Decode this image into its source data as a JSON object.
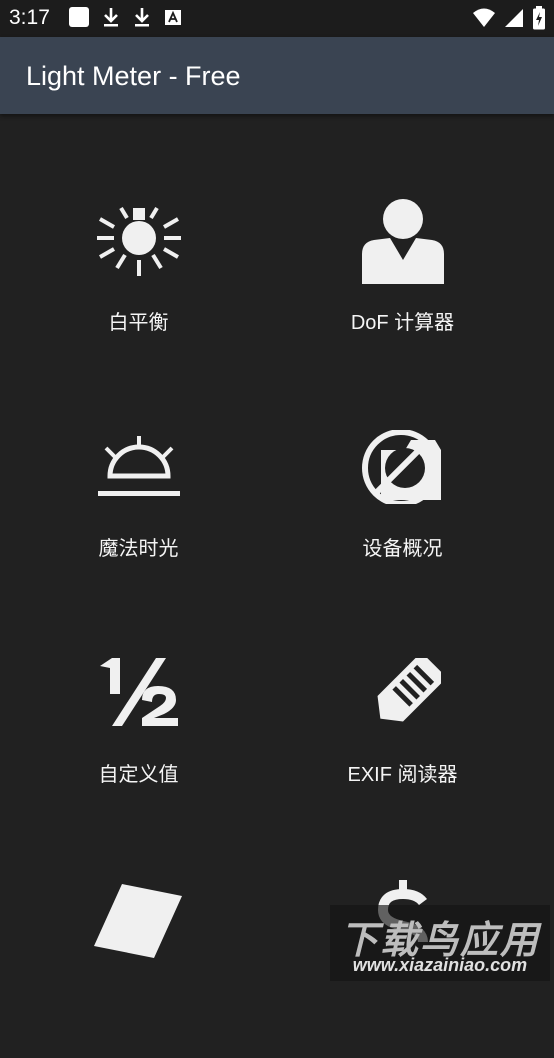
{
  "status_bar": {
    "time": "3:17",
    "left_icons": [
      "notification-square-icon",
      "download-icon",
      "download-icon",
      "font-icon"
    ],
    "right_icons": [
      "wifi-icon",
      "signal-icon",
      "battery-charging-icon"
    ]
  },
  "app_bar": {
    "title": "Light Meter - Free",
    "color": "#3a4452"
  },
  "menu": {
    "items": [
      {
        "label": "白平衡",
        "icon": "lightbulb-icon"
      },
      {
        "label": "DoF 计算器",
        "icon": "person-icon"
      },
      {
        "label": "魔法时光",
        "icon": "sunrise-icon"
      },
      {
        "label": "设备概况",
        "icon": "camera-disabled-icon"
      },
      {
        "label": "自定义值",
        "icon": "one-half-icon"
      },
      {
        "label": "EXIF 阅读器",
        "icon": "tag-icon"
      },
      {
        "label": "",
        "icon": "gray-card-icon"
      },
      {
        "label": "",
        "icon": "dollar-icon"
      }
    ]
  },
  "watermark": {
    "title": "下载鸟应用",
    "url": "www.xiazainiao.com"
  }
}
